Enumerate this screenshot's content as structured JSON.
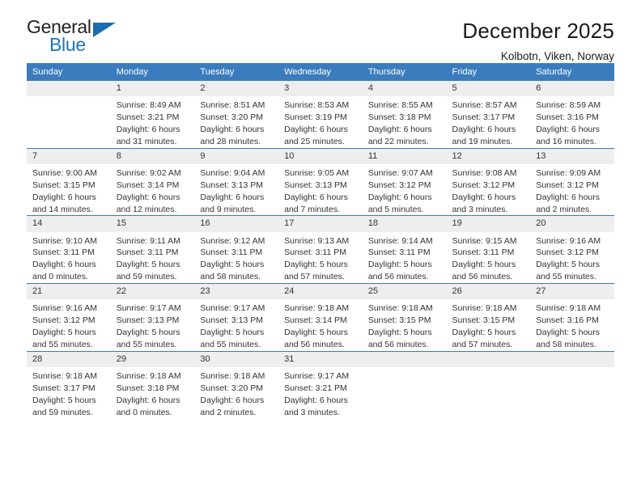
{
  "logo": {
    "word_top": "General",
    "word_bottom": "Blue",
    "accent_color": "#1b6cb0"
  },
  "header": {
    "title": "December 2025",
    "subtitle": "Kolbotn, Viken, Norway"
  },
  "theme": {
    "header_blue": "#3a7cbe",
    "daynum_gray": "#eeeeee",
    "text": "#333333"
  },
  "calendar": {
    "weekday_headers": [
      "Sunday",
      "Monday",
      "Tuesday",
      "Wednesday",
      "Thursday",
      "Friday",
      "Saturday"
    ],
    "weeks": [
      [
        {
          "day": "",
          "sunrise": "",
          "sunset": "",
          "daylight_a": "",
          "daylight_b": "",
          "empty": true
        },
        {
          "day": "1",
          "sunrise": "Sunrise: 8:49 AM",
          "sunset": "Sunset: 3:21 PM",
          "daylight_a": "Daylight: 6 hours",
          "daylight_b": "and 31 minutes."
        },
        {
          "day": "2",
          "sunrise": "Sunrise: 8:51 AM",
          "sunset": "Sunset: 3:20 PM",
          "daylight_a": "Daylight: 6 hours",
          "daylight_b": "and 28 minutes."
        },
        {
          "day": "3",
          "sunrise": "Sunrise: 8:53 AM",
          "sunset": "Sunset: 3:19 PM",
          "daylight_a": "Daylight: 6 hours",
          "daylight_b": "and 25 minutes."
        },
        {
          "day": "4",
          "sunrise": "Sunrise: 8:55 AM",
          "sunset": "Sunset: 3:18 PM",
          "daylight_a": "Daylight: 6 hours",
          "daylight_b": "and 22 minutes."
        },
        {
          "day": "5",
          "sunrise": "Sunrise: 8:57 AM",
          "sunset": "Sunset: 3:17 PM",
          "daylight_a": "Daylight: 6 hours",
          "daylight_b": "and 19 minutes."
        },
        {
          "day": "6",
          "sunrise": "Sunrise: 8:59 AM",
          "sunset": "Sunset: 3:16 PM",
          "daylight_a": "Daylight: 6 hours",
          "daylight_b": "and 16 minutes."
        }
      ],
      [
        {
          "day": "7",
          "sunrise": "Sunrise: 9:00 AM",
          "sunset": "Sunset: 3:15 PM",
          "daylight_a": "Daylight: 6 hours",
          "daylight_b": "and 14 minutes."
        },
        {
          "day": "8",
          "sunrise": "Sunrise: 9:02 AM",
          "sunset": "Sunset: 3:14 PM",
          "daylight_a": "Daylight: 6 hours",
          "daylight_b": "and 12 minutes."
        },
        {
          "day": "9",
          "sunrise": "Sunrise: 9:04 AM",
          "sunset": "Sunset: 3:13 PM",
          "daylight_a": "Daylight: 6 hours",
          "daylight_b": "and 9 minutes."
        },
        {
          "day": "10",
          "sunrise": "Sunrise: 9:05 AM",
          "sunset": "Sunset: 3:13 PM",
          "daylight_a": "Daylight: 6 hours",
          "daylight_b": "and 7 minutes."
        },
        {
          "day": "11",
          "sunrise": "Sunrise: 9:07 AM",
          "sunset": "Sunset: 3:12 PM",
          "daylight_a": "Daylight: 6 hours",
          "daylight_b": "and 5 minutes."
        },
        {
          "day": "12",
          "sunrise": "Sunrise: 9:08 AM",
          "sunset": "Sunset: 3:12 PM",
          "daylight_a": "Daylight: 6 hours",
          "daylight_b": "and 3 minutes."
        },
        {
          "day": "13",
          "sunrise": "Sunrise: 9:09 AM",
          "sunset": "Sunset: 3:12 PM",
          "daylight_a": "Daylight: 6 hours",
          "daylight_b": "and 2 minutes."
        }
      ],
      [
        {
          "day": "14",
          "sunrise": "Sunrise: 9:10 AM",
          "sunset": "Sunset: 3:11 PM",
          "daylight_a": "Daylight: 6 hours",
          "daylight_b": "and 0 minutes."
        },
        {
          "day": "15",
          "sunrise": "Sunrise: 9:11 AM",
          "sunset": "Sunset: 3:11 PM",
          "daylight_a": "Daylight: 5 hours",
          "daylight_b": "and 59 minutes."
        },
        {
          "day": "16",
          "sunrise": "Sunrise: 9:12 AM",
          "sunset": "Sunset: 3:11 PM",
          "daylight_a": "Daylight: 5 hours",
          "daylight_b": "and 58 minutes."
        },
        {
          "day": "17",
          "sunrise": "Sunrise: 9:13 AM",
          "sunset": "Sunset: 3:11 PM",
          "daylight_a": "Daylight: 5 hours",
          "daylight_b": "and 57 minutes."
        },
        {
          "day": "18",
          "sunrise": "Sunrise: 9:14 AM",
          "sunset": "Sunset: 3:11 PM",
          "daylight_a": "Daylight: 5 hours",
          "daylight_b": "and 56 minutes."
        },
        {
          "day": "19",
          "sunrise": "Sunrise: 9:15 AM",
          "sunset": "Sunset: 3:11 PM",
          "daylight_a": "Daylight: 5 hours",
          "daylight_b": "and 56 minutes."
        },
        {
          "day": "20",
          "sunrise": "Sunrise: 9:16 AM",
          "sunset": "Sunset: 3:12 PM",
          "daylight_a": "Daylight: 5 hours",
          "daylight_b": "and 55 minutes."
        }
      ],
      [
        {
          "day": "21",
          "sunrise": "Sunrise: 9:16 AM",
          "sunset": "Sunset: 3:12 PM",
          "daylight_a": "Daylight: 5 hours",
          "daylight_b": "and 55 minutes."
        },
        {
          "day": "22",
          "sunrise": "Sunrise: 9:17 AM",
          "sunset": "Sunset: 3:13 PM",
          "daylight_a": "Daylight: 5 hours",
          "daylight_b": "and 55 minutes."
        },
        {
          "day": "23",
          "sunrise": "Sunrise: 9:17 AM",
          "sunset": "Sunset: 3:13 PM",
          "daylight_a": "Daylight: 5 hours",
          "daylight_b": "and 55 minutes."
        },
        {
          "day": "24",
          "sunrise": "Sunrise: 9:18 AM",
          "sunset": "Sunset: 3:14 PM",
          "daylight_a": "Daylight: 5 hours",
          "daylight_b": "and 56 minutes."
        },
        {
          "day": "25",
          "sunrise": "Sunrise: 9:18 AM",
          "sunset": "Sunset: 3:15 PM",
          "daylight_a": "Daylight: 5 hours",
          "daylight_b": "and 56 minutes."
        },
        {
          "day": "26",
          "sunrise": "Sunrise: 9:18 AM",
          "sunset": "Sunset: 3:15 PM",
          "daylight_a": "Daylight: 5 hours",
          "daylight_b": "and 57 minutes."
        },
        {
          "day": "27",
          "sunrise": "Sunrise: 9:18 AM",
          "sunset": "Sunset: 3:16 PM",
          "daylight_a": "Daylight: 5 hours",
          "daylight_b": "and 58 minutes."
        }
      ],
      [
        {
          "day": "28",
          "sunrise": "Sunrise: 9:18 AM",
          "sunset": "Sunset: 3:17 PM",
          "daylight_a": "Daylight: 5 hours",
          "daylight_b": "and 59 minutes."
        },
        {
          "day": "29",
          "sunrise": "Sunrise: 9:18 AM",
          "sunset": "Sunset: 3:18 PM",
          "daylight_a": "Daylight: 6 hours",
          "daylight_b": "and 0 minutes."
        },
        {
          "day": "30",
          "sunrise": "Sunrise: 9:18 AM",
          "sunset": "Sunset: 3:20 PM",
          "daylight_a": "Daylight: 6 hours",
          "daylight_b": "and 2 minutes."
        },
        {
          "day": "31",
          "sunrise": "Sunrise: 9:17 AM",
          "sunset": "Sunset: 3:21 PM",
          "daylight_a": "Daylight: 6 hours",
          "daylight_b": "and 3 minutes."
        },
        {
          "day": "",
          "sunrise": "",
          "sunset": "",
          "daylight_a": "",
          "daylight_b": "",
          "empty": true
        },
        {
          "day": "",
          "sunrise": "",
          "sunset": "",
          "daylight_a": "",
          "daylight_b": "",
          "empty": true
        },
        {
          "day": "",
          "sunrise": "",
          "sunset": "",
          "daylight_a": "",
          "daylight_b": "",
          "empty": true
        }
      ]
    ]
  }
}
